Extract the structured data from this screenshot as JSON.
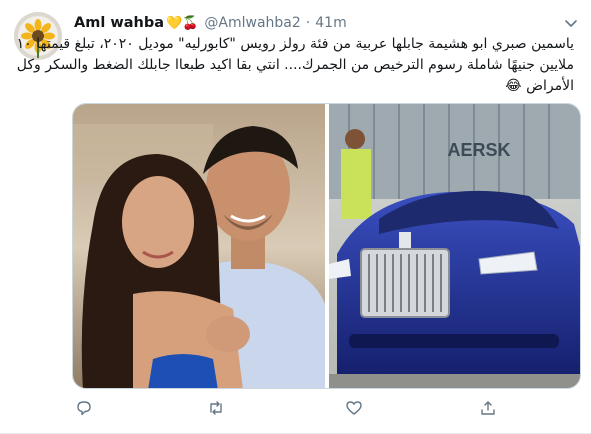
{
  "tweet": {
    "author": {
      "display_name": "Aml wahba",
      "name_emojis": "💛🍒",
      "handle": "@Amlwahba2",
      "separator": "·",
      "timestamp": "41m"
    },
    "text_lines": [
      "ياسمين صبري ابو هشيمة جابلها عربية  من فئة رولز رويس \"كابورليه\" موديل ٢٠٢٠، تبلغ قيمتها ١٠",
      "ملايين جنيهًا شاملة رسوم الترخيص من الجمرك.... انتي بقا اكيد طبعاا جابلك الضغط والسكر وكل",
      "الأمراض 😂"
    ],
    "media": {
      "left_photo": "couple-photo",
      "right_photo": "car-photo",
      "container_text": "AERSK"
    },
    "actions": {
      "reply_icon": "reply-icon",
      "retweet_icon": "retweet-icon",
      "like_icon": "like-icon",
      "share_icon": "share-icon"
    },
    "colors": {
      "text": "#14171a",
      "secondary": "#657786",
      "border": "#e6ecf0",
      "car_blue": "#1f2f8f"
    }
  }
}
